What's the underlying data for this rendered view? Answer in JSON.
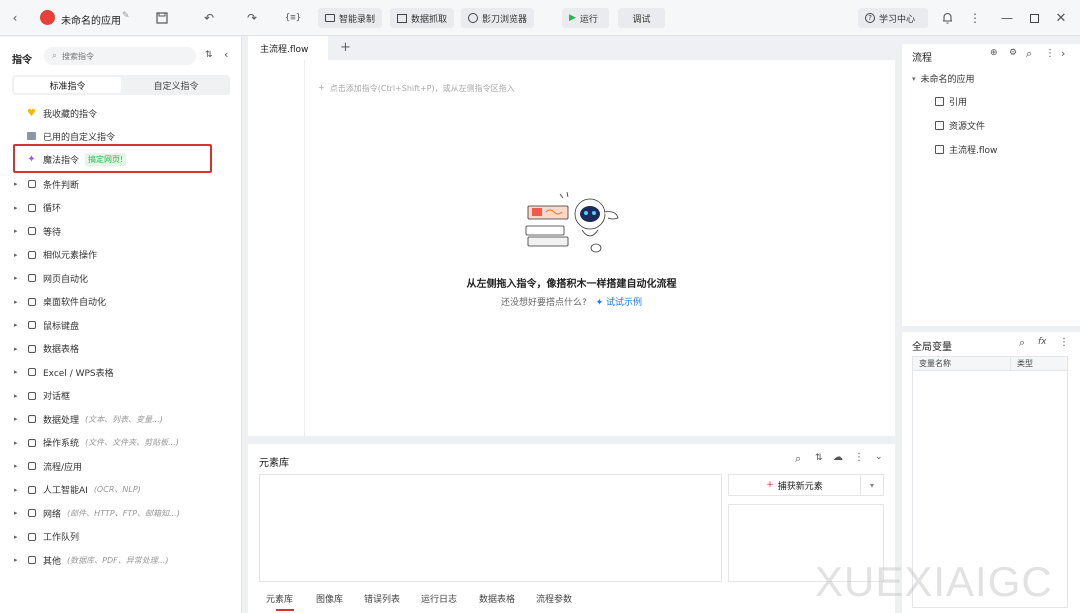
{
  "titlebar": {
    "app_name": "未命名的应用",
    "smart_record": "智能录制",
    "data_capture": "数据抓取",
    "browser": "影刀浏览器",
    "run": "运行",
    "debug": "调试",
    "learning_center": "学习中心"
  },
  "left_panel": {
    "title": "指令",
    "search_placeholder": "搜索指令",
    "tabs": [
      "标准指令",
      "自定义指令"
    ],
    "special_items": [
      {
        "label": "我收藏的指令",
        "icon": "heart-icon"
      },
      {
        "label": "已用的自定义指令",
        "icon": "box-icon"
      },
      {
        "label": "魔法指令",
        "icon": "sparkle-icon",
        "tag": "搞定网页!"
      }
    ],
    "items": [
      {
        "label": "条件判断",
        "hint": "",
        "icon": "branch-icon"
      },
      {
        "label": "循环",
        "hint": "",
        "icon": "loop-icon"
      },
      {
        "label": "等待",
        "hint": "",
        "icon": "hourglass-icon"
      },
      {
        "label": "相似元素操作",
        "hint": "",
        "icon": "copy-icon"
      },
      {
        "label": "网页自动化",
        "hint": "",
        "icon": "web-icon"
      },
      {
        "label": "桌面软件自动化",
        "hint": "",
        "icon": "desktop-icon"
      },
      {
        "label": "鼠标键盘",
        "hint": "",
        "icon": "cursor-icon"
      },
      {
        "label": "数据表格",
        "hint": "",
        "icon": "table-icon"
      },
      {
        "label": "Excel / WPS表格",
        "hint": "",
        "icon": "excel-icon"
      },
      {
        "label": "对话框",
        "hint": "",
        "icon": "dialog-icon"
      },
      {
        "label": "数据处理",
        "hint": "(文本、列表、变量...)",
        "icon": "data-icon"
      },
      {
        "label": "操作系统",
        "hint": "(文件、文件夹、剪贴板...)",
        "icon": "os-icon"
      },
      {
        "label": "流程/应用",
        "hint": "",
        "icon": "layers-icon"
      },
      {
        "label": "人工智能AI",
        "hint": "(OCR、NLP)",
        "icon": "ai-icon"
      },
      {
        "label": "网络",
        "hint": "(邮件、HTTP、FTP、邮箱知...)",
        "icon": "network-icon"
      },
      {
        "label": "工作队列",
        "hint": "",
        "icon": "queue-icon"
      },
      {
        "label": "其他",
        "hint": "(数据库、PDF、异常处理...)",
        "icon": "grid-icon"
      }
    ]
  },
  "editor": {
    "tab": "主流程.flow",
    "add_hint": "点击添加指令(Ctrl+Shift+P)，或从左侧指令区拖入",
    "empty_title": "从左侧拖入指令，像搭积木一样搭建自动化流程",
    "empty_sub": "还没想好要搭点什么?",
    "try_example": "试试示例"
  },
  "element_library": {
    "title": "元素库",
    "capture_button": "捕获新元素",
    "bottom_tabs": [
      "元素库",
      "图像库",
      "错误列表",
      "运行日志",
      "数据表格",
      "流程参数"
    ]
  },
  "flow_panel": {
    "title": "流程",
    "root": "未命名的应用",
    "items": [
      {
        "label": "引用",
        "icon": "reference-icon"
      },
      {
        "label": "资源文件",
        "icon": "resource-icon"
      },
      {
        "label": "主流程.flow",
        "icon": "flow-icon"
      }
    ]
  },
  "global_vars": {
    "title": "全局变量",
    "columns": [
      "变量名称",
      "类型"
    ]
  },
  "watermark": "XUEXIAIGC",
  "colors": {
    "highlight_border": "#d9342b",
    "accent": "#1677ff",
    "green_tag": "#2ab552"
  }
}
